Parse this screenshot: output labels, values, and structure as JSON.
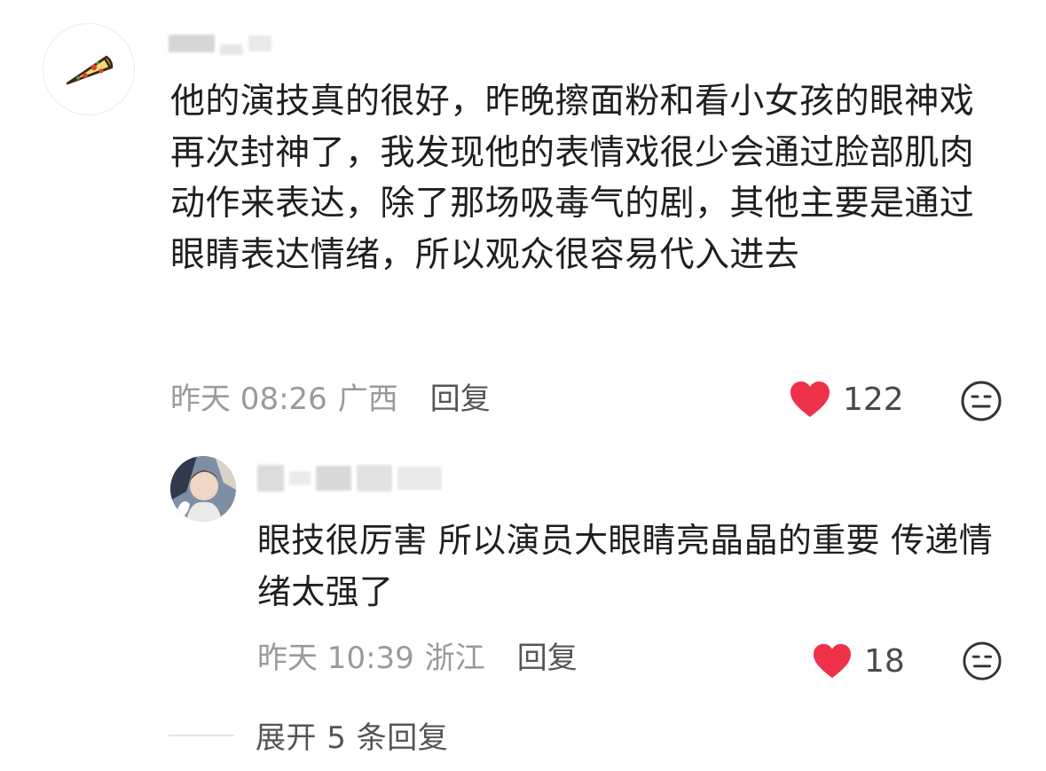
{
  "comment": {
    "avatar_icon": "pizza-slice-icon",
    "text": "他的演技真的很好，昨晚擦面粉和看小女孩的眼神戏再次封神了，我发现他的表情戏很少会通过脸部肌肉动作来表达，除了那场吸毒气的剧，其他主要是通过眼睛表达情绪，所以观众很容易代入进去",
    "time": "昨天 08:26",
    "location": "广西",
    "reply_label": "回复",
    "like_count": "122"
  },
  "reply": {
    "text": "眼技很厉害 所以演员大眼睛亮晶晶的重要 传递情绪太强了",
    "time": "昨天 10:39",
    "location": "浙江",
    "reply_label": "回复",
    "like_count": "18"
  },
  "expand": {
    "label": "展开 5 条回复"
  },
  "colors": {
    "like_heart": "#f0314a",
    "meta_gray": "#9a9a9a",
    "text_dark": "#1f1f1f"
  }
}
